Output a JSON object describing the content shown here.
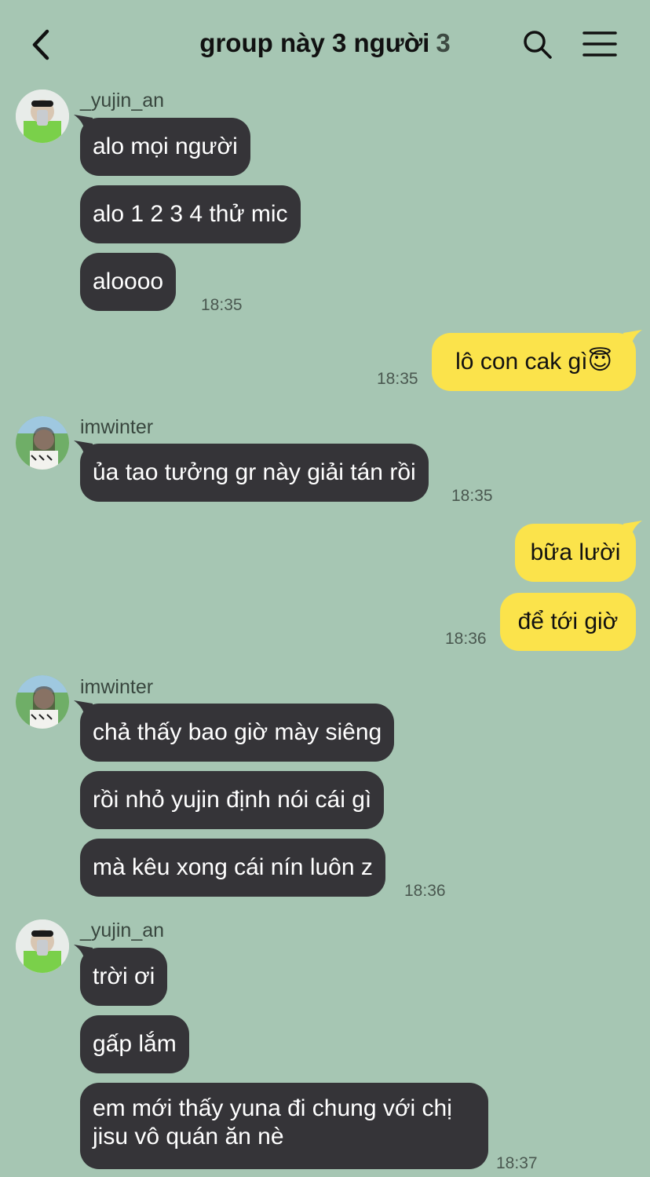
{
  "header": {
    "title": "group này 3 người",
    "member_count": "3",
    "back_icon": "chevron-left-icon",
    "search_icon": "search-icon",
    "menu_icon": "hamburger-menu-icon"
  },
  "messages": [
    {
      "sender": "_yujin_an",
      "text": "alo mọi người"
    },
    {
      "text": "alo 1 2 3 4 thử mic"
    },
    {
      "text": "aloooo",
      "time": "18:35"
    },
    {
      "outgoing": true,
      "text": "lô con cak gì😇",
      "time": "18:35"
    },
    {
      "sender": "imwinter",
      "text": "ủa tao tưởng gr này giải tán rồi",
      "time": "18:35"
    },
    {
      "outgoing": true,
      "text": "bữa lười"
    },
    {
      "outgoing": true,
      "text": "để tới giờ",
      "time": "18:36"
    },
    {
      "sender": "imwinter",
      "text": "chả thấy bao giờ mày siêng"
    },
    {
      "text": "rồi nhỏ yujin định nói cái gì"
    },
    {
      "text": "mà kêu xong cái nín luôn z",
      "time": "18:36"
    },
    {
      "sender": "_yujin_an",
      "text": "trời ơi"
    },
    {
      "text": "gấp lắm"
    },
    {
      "text": "em mới thấy yuna đi chung với chị jisu vô quán ăn nè",
      "time": "18:37"
    }
  ],
  "colors": {
    "background": "#a6c6b3",
    "incoming_bubble": "#353438",
    "outgoing_bubble": "#fbe34b"
  }
}
